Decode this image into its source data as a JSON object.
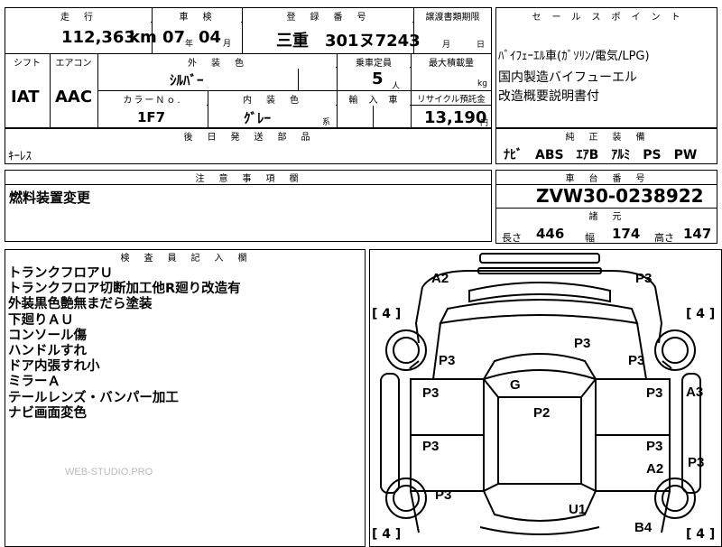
{
  "top_left": {
    "mileage_label": "走　行",
    "mileage_value": "112,363",
    "mileage_unit": "km",
    "inspection_label": "車　検",
    "inspection_year": "07",
    "inspection_year_unit": "年",
    "inspection_month": "04",
    "inspection_month_unit": "月",
    "registration_label": "登　録　番　号",
    "registration_value": "三重　301ヌ7243",
    "transfer_label": "譲渡書類期限",
    "transfer_month_unit": "月",
    "transfer_day_unit": "日"
  },
  "row2": {
    "shift_label": "シフト",
    "shift_value": "IAT",
    "ac_label": "エアコン",
    "ac_value": "AAC",
    "exterior_color_label": "外　装　色",
    "exterior_color_value": "ｼﾙﾊﾞｰ",
    "capacity_label": "乗車定員",
    "capacity_value": "5",
    "capacity_unit": "人",
    "load_label": "最大積載量",
    "load_unit": "kg",
    "color_no_label": "カラーＮｏ.",
    "color_no_value": "1F7",
    "interior_color_label": "内　装　色",
    "interior_color_value": "ｸﾞﾚｰ",
    "interior_color_suffix": "系",
    "import_label": "輸　入　車",
    "recycle_label": "リサイクル預託金",
    "recycle_value": "13,190",
    "recycle_unit": "円"
  },
  "parts": {
    "label": "後　日　発　送　部　品",
    "value": "ｷｰﾚｽ"
  },
  "caution": {
    "label": "注　意　事　項　欄",
    "value": "燃料装置変更"
  },
  "inspector": {
    "label": "検　査　員　記　入　欄",
    "notes": [
      "トランクフロアＵ",
      "トランクフロア切断加工他R廻り改造有",
      "外装黒色艶無まだら塗装",
      "下廻りＡＵ",
      "コンソール傷",
      "ハンドルすれ",
      "ドア内張すれ小",
      "ミラーＡ",
      "テールレンズ・バンパー加工",
      "ナビ画面変色"
    ]
  },
  "sales_point": {
    "label": "セ　ー　ル　ス　ポ　イ　ン　ト",
    "lines": [
      "ﾊﾞｲﾌｪｰｴﾙ車(ｶﾞｿﾘﾝ/電気/LPG)",
      "国内製造バイフューエル",
      "改造概要説明書付"
    ]
  },
  "equipment": {
    "label": "純　正　装　備",
    "value": "ﾅﾋﾞ　ABS　ｴｱB　ｱﾙﾐ　PS　PW"
  },
  "chassis": {
    "label": "車　台　番　号",
    "value": "ZVW30-0238922"
  },
  "specs": {
    "label": "諸　元",
    "length_label": "長さ",
    "length_value": "446",
    "width_label": "幅",
    "width_value": "174",
    "height_label": "高さ",
    "height_value": "147"
  },
  "diagram": {
    "tire_label": "[ 4 ]",
    "marks": {
      "front_left": "A2",
      "front_right": "P3",
      "hood": "P3",
      "fender_left": "P3",
      "fender_right": "P3",
      "roof": "G",
      "cabin": "P2",
      "front_door_left": "P3",
      "front_door_right": "P3",
      "right_side": "A3",
      "rear_door_left": "P3",
      "rear_door_right": "P3",
      "rear_door_right2": "A2",
      "right_side_rear": "P3",
      "rear_quarter_left": "P3",
      "trunk": "U1",
      "rear_bumper": "B4"
    }
  },
  "watermark": "WEB-STUDIO.PRO",
  "colors": {
    "line": "#000000",
    "watermark": "#bbbbbb"
  }
}
